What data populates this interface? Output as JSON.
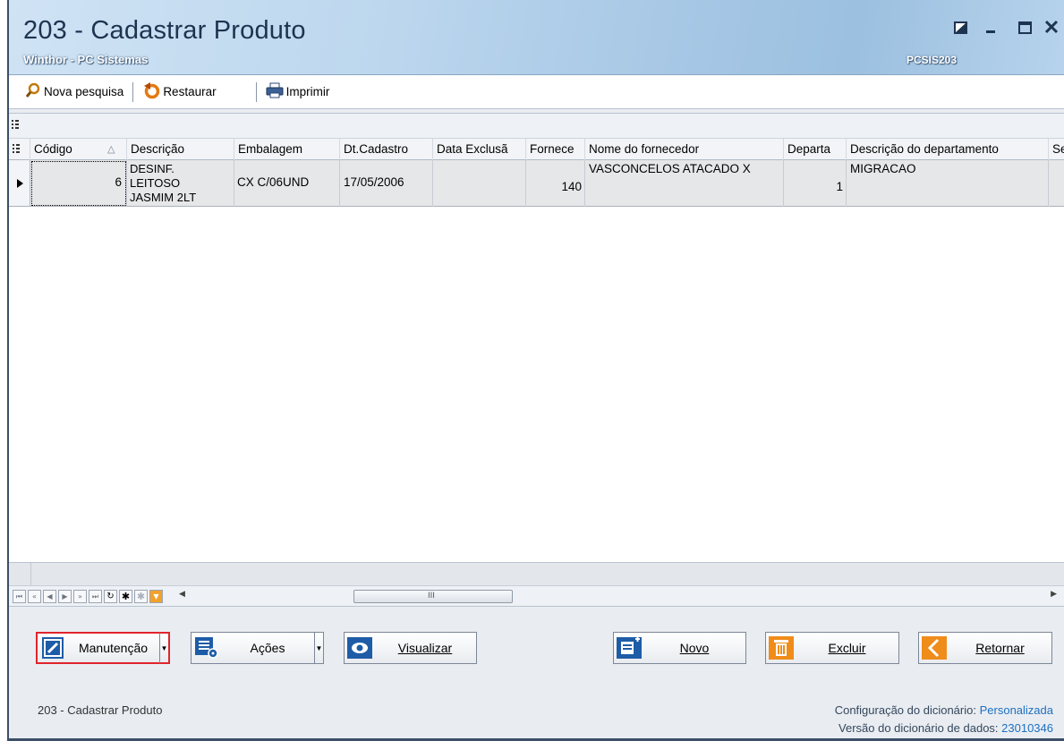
{
  "window": {
    "title": "203 - Cadastrar  Produto",
    "subtitle": "Winthor - PC Sistemas",
    "routine_code": "PCSIS203"
  },
  "toolbar": {
    "search_label": "Nova pesquisa",
    "restore_label": "Restaurar",
    "print_label": "Imprimir"
  },
  "grid": {
    "columns": [
      "Código",
      "Descrição",
      "Embalagem",
      "Dt.Cadastro",
      "Data Exclusão",
      "Fornecedor",
      "Nome do fornecedor",
      "Departamento",
      "Descrição do departamento",
      "Se"
    ],
    "column_display": [
      "Código",
      "Descrição",
      "Embalagem",
      "Dt.Cadastro",
      "Data Exclusã",
      "Fornece",
      "Nome do fornecedor",
      "Departa",
      "Descrição do departamento",
      "Se"
    ],
    "rows": [
      {
        "codigo": "6",
        "descricao_l1": "DESINF.",
        "descricao_l2": "LEITOSO",
        "descricao_l3": "JASMIM 2LT",
        "embalagem": "CX C/06UND",
        "dt_cadastro": "17/05/2006",
        "data_exclusao": "",
        "fornecedor": "140",
        "nome_fornecedor": "VASCONCELOS ATACADO X",
        "departamento": "1",
        "descricao_departamento": "MIGRACAO"
      }
    ],
    "hscroll_grip": "III"
  },
  "buttons": {
    "manutencao": "Manutenção",
    "acoes": "Ações",
    "visualizar": "Visualizar",
    "novo": "Novo",
    "excluir": "Excluir",
    "retornar": "Retornar"
  },
  "status": {
    "left": "203 - Cadastrar  Produto",
    "dict_config_label": "Configuração do dicionário:",
    "dict_config_value": "Personalizada",
    "dict_version_label": "Versão do dicionário de dados:",
    "dict_version_value": "23010346"
  },
  "colors": {
    "highlight_border": "#e0242c",
    "icon_blue": "#1e5ca8",
    "icon_orange": "#f08c1a",
    "link_blue": "#1f6fbf"
  }
}
